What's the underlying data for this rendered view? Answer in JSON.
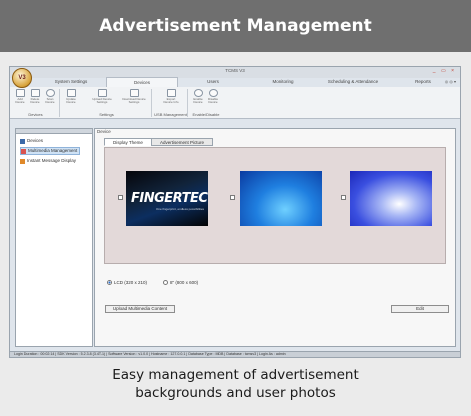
{
  "banner": {
    "title": "Advertisement Management"
  },
  "caption": {
    "line1": "Easy management of advertisement",
    "line2": "backgrounds and user photos"
  },
  "app": {
    "title": "TCMS V3",
    "window_controls": "_ ▭ ×",
    "tabs": [
      {
        "label": "System Settings",
        "active": false
      },
      {
        "label": "Devices",
        "active": true
      },
      {
        "label": "Users",
        "active": false
      },
      {
        "label": "Monitoring",
        "active": false
      },
      {
        "label": "Scheduling & Attendance",
        "active": false
      },
      {
        "label": "Reports",
        "active": false
      }
    ],
    "tab_icons": "◎ ◎ ▾",
    "ribbon": {
      "groups": [
        {
          "name": "Devices",
          "buttons": [
            "Add Device",
            "Delete Device",
            "Scan Device"
          ]
        },
        {
          "name": "Settings",
          "buttons": [
            "Update Device",
            "Upload Device Settings",
            "Download Device Settings"
          ]
        },
        {
          "name": "USB Management",
          "buttons": [
            "Export Device Info"
          ]
        },
        {
          "name": "Enable/Disable",
          "buttons": [
            "Enable Device",
            "Disable Device"
          ]
        }
      ]
    },
    "tree": {
      "items": [
        {
          "label": "Devices",
          "selected": false
        },
        {
          "label": "Multimedia Management",
          "selected": true
        },
        {
          "label": "Instant Message Display",
          "selected": false
        }
      ]
    },
    "main": {
      "title": "Device",
      "subtabs": [
        {
          "label": "Display Theme",
          "active": true
        },
        {
          "label": "Advertisement Picture",
          "active": false
        }
      ],
      "thumbnail_brand": "FINGERTEC",
      "thumbnail_tagline": "One fingerprint, endless possibilities",
      "radios": [
        {
          "label": "LCD (320 x 210)",
          "checked": true
        },
        {
          "label": "8\" (800 x 600)",
          "checked": false
        }
      ],
      "upload_button": "Upload Multimedia Content",
      "edit_button": "Edit"
    },
    "status_bar": "Login Duration : 00:02:14   |   SDK Version : 5.2.3.8 (3.4T-1)   |   Software Version : v1.0.0   |   Hostname : 127.0.0.1   |   Database Type : MDB   |   Database : tcmsv3   |   Login As : admin"
  },
  "colors": {
    "banner_bg": "#6f6f6f",
    "page_bg": "#ebebeb",
    "selected_item": "#cfe2f5",
    "preview_bg": "#e3d9d9"
  }
}
